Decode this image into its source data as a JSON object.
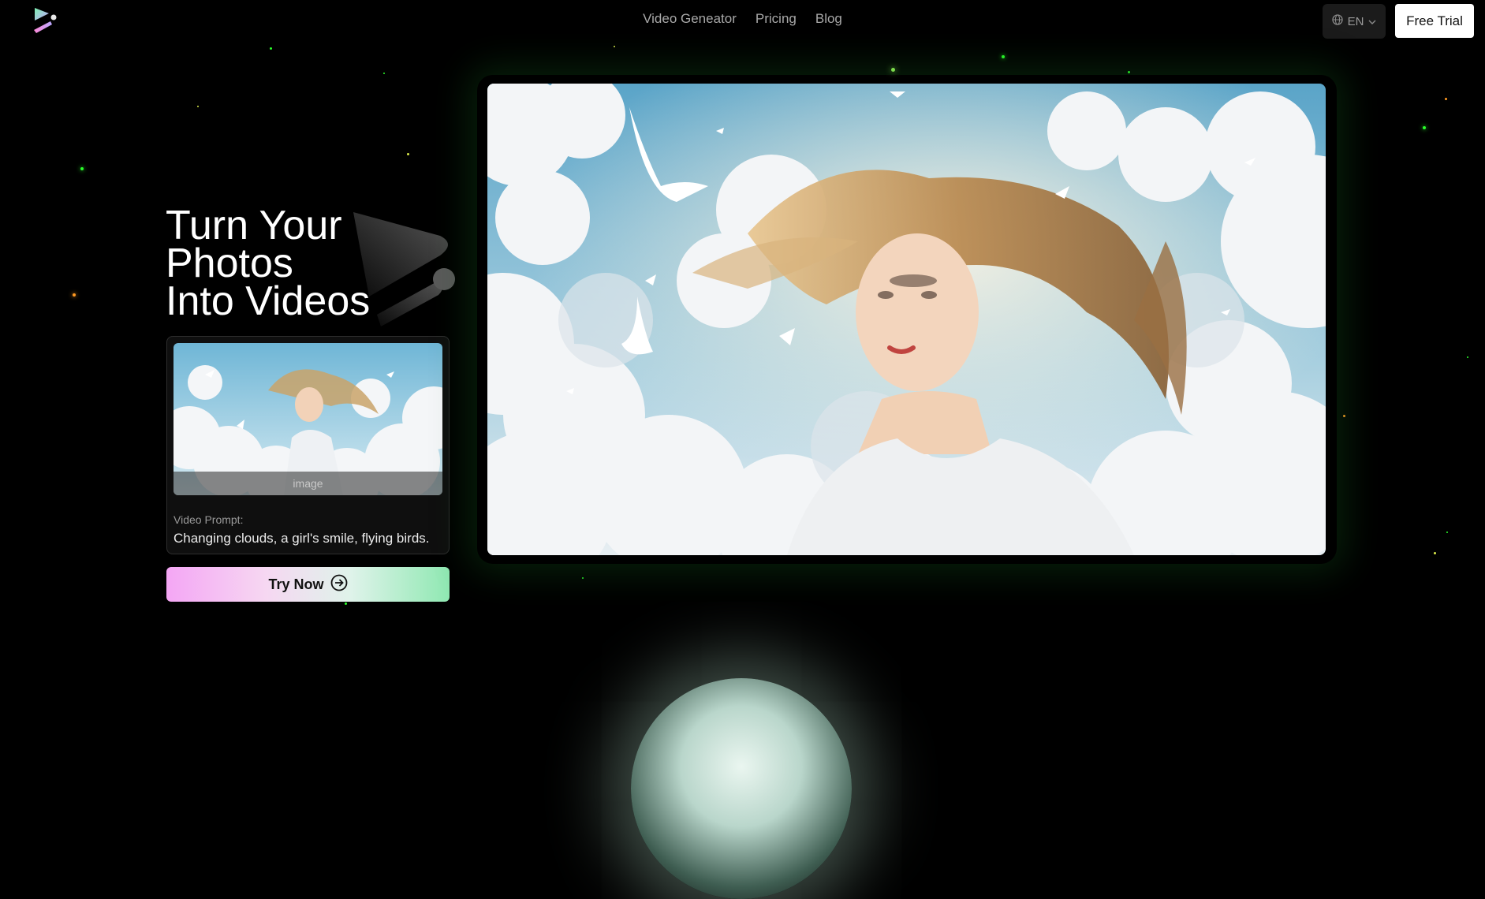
{
  "nav": {
    "links": [
      "Video Geneator",
      "Pricing",
      "Blog"
    ],
    "lang": "EN",
    "cta": "Free Trial"
  },
  "hero": {
    "title_lines": [
      "Turn Your",
      "Photos",
      "Into Videos"
    ],
    "card": {
      "image_label": "image",
      "prompt_label": "Video Prompt:",
      "prompt_text": "Changing clouds, a girl's smile, flying birds."
    },
    "try_button": "Try Now"
  },
  "icons": [
    "app-logo-icon",
    "globe-icon",
    "chevron-down-icon",
    "arrow-circle-right-icon"
  ],
  "colors": {
    "background": "#000000",
    "nav_text": "#a8a8a8",
    "accent_pink": "#f4a6f4",
    "accent_green": "#8fe8b2"
  }
}
